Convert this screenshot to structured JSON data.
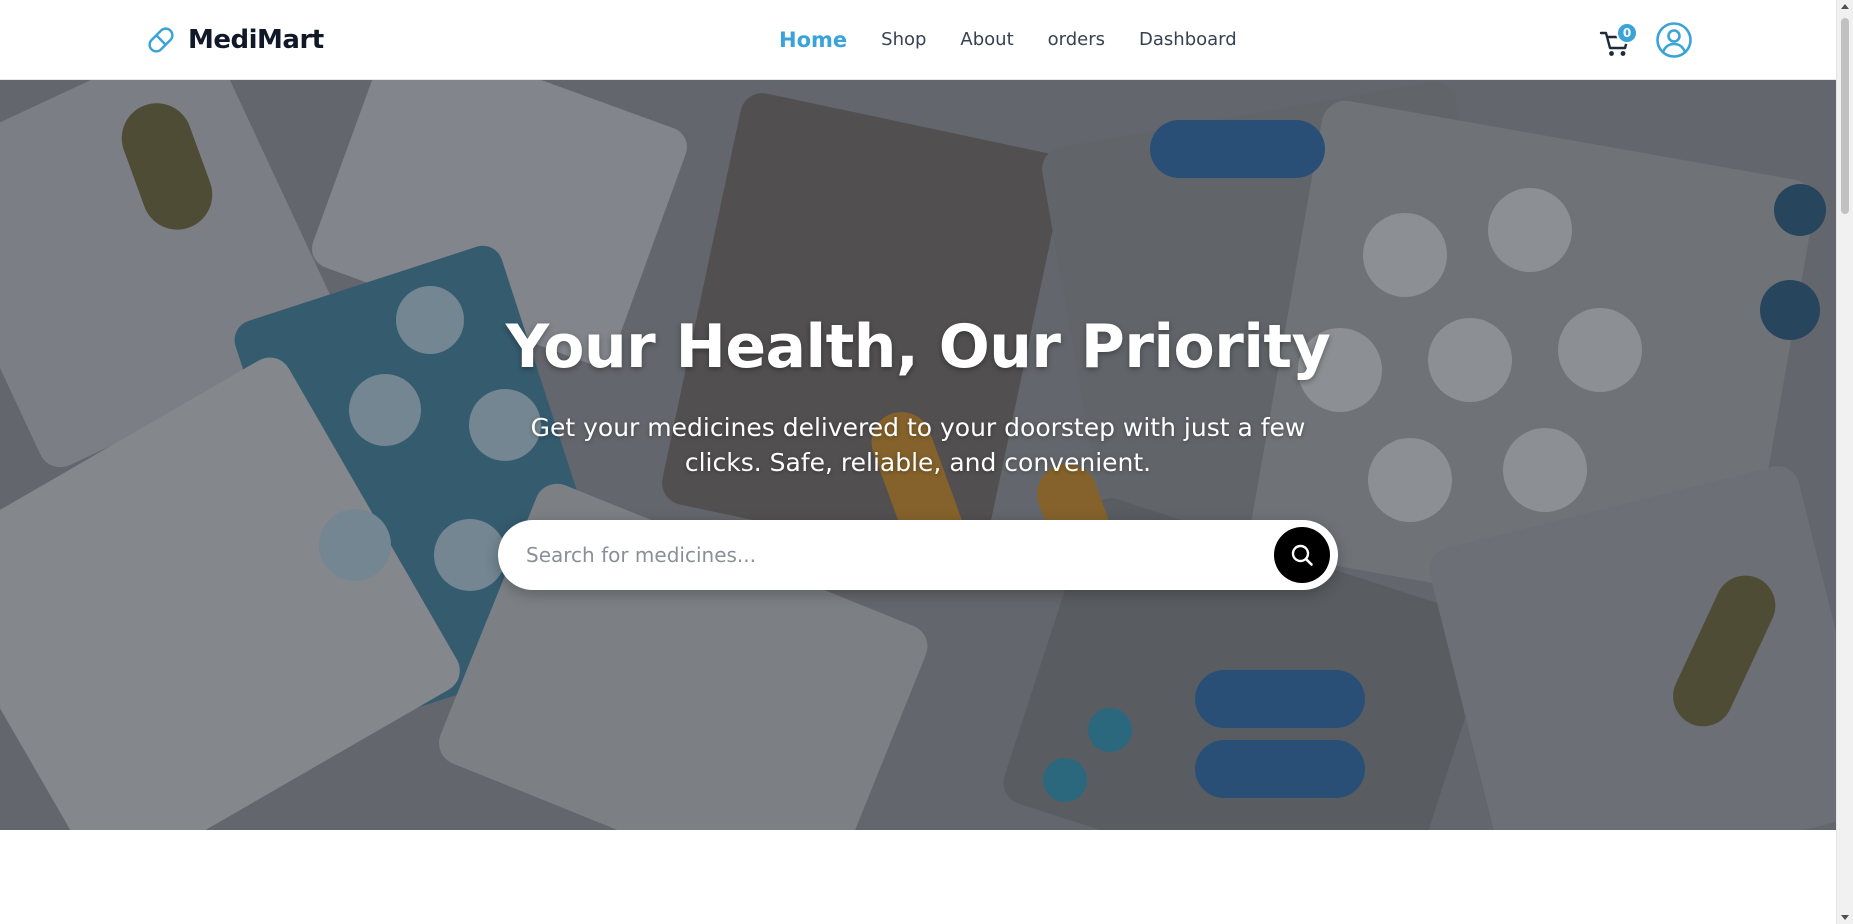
{
  "brand": {
    "name": "MediMart",
    "icon": "pill-icon"
  },
  "nav": {
    "links": [
      {
        "label": "Home",
        "active": true
      },
      {
        "label": "Shop",
        "active": false
      },
      {
        "label": "About",
        "active": false
      },
      {
        "label": "orders",
        "active": false
      },
      {
        "label": "Dashboard",
        "active": false
      }
    ]
  },
  "cart": {
    "icon": "cart-icon",
    "count": "0"
  },
  "account": {
    "icon": "user-circle-icon"
  },
  "hero": {
    "title": "Your Health, Our Priority",
    "subtitle": "Get your medicines delivered to your doorstep with just a few clicks. Safe, reliable, and convenient.",
    "background": "blister-packs-of-pills-photo"
  },
  "search": {
    "placeholder": "Search for medicines...",
    "value": "",
    "button_icon": "search-icon"
  },
  "colors": {
    "accent": "#3aa3d8",
    "text": "#1f2937",
    "search_button": "#000000"
  }
}
